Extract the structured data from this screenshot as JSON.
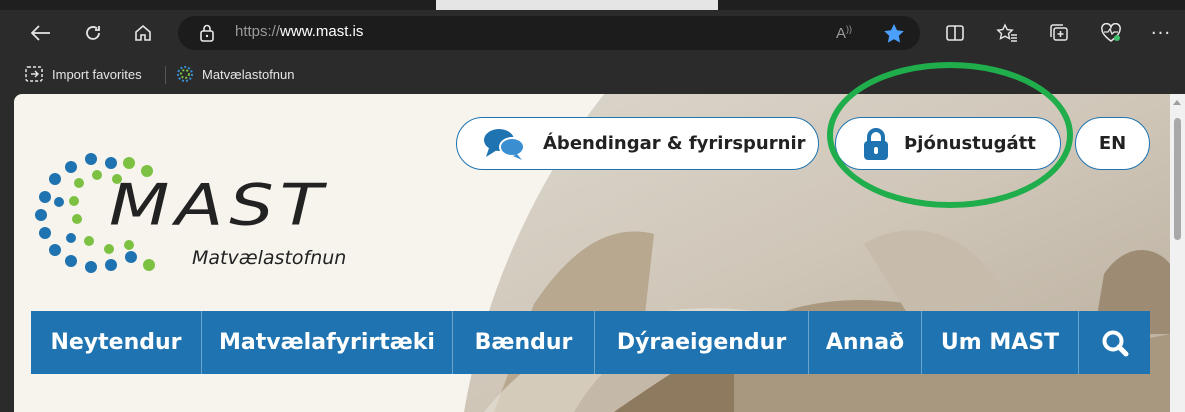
{
  "browser": {
    "url_prefix": "https://",
    "url_host": "www.mast.is",
    "favorites": [
      {
        "label": "Import favorites"
      },
      {
        "label": "Matvælastofnun"
      }
    ]
  },
  "site": {
    "logo_word": "MAST",
    "logo_sub": "Matvælastofnun",
    "header_buttons": {
      "feedback": "Ábendingar & fyrirspurnir",
      "portal": "Þjónustugátt",
      "lang": "EN"
    },
    "nav": [
      {
        "label": "Neytendur"
      },
      {
        "label": "Matvælafyrirtæki"
      },
      {
        "label": "Bændur"
      },
      {
        "label": "Dýraeigendur"
      },
      {
        "label": "Annað"
      },
      {
        "label": "Um MAST"
      }
    ]
  },
  "colors": {
    "brand_blue": "#1e73b0",
    "logo_green": "#7cc142",
    "highlight_green": "#1fae4b"
  }
}
